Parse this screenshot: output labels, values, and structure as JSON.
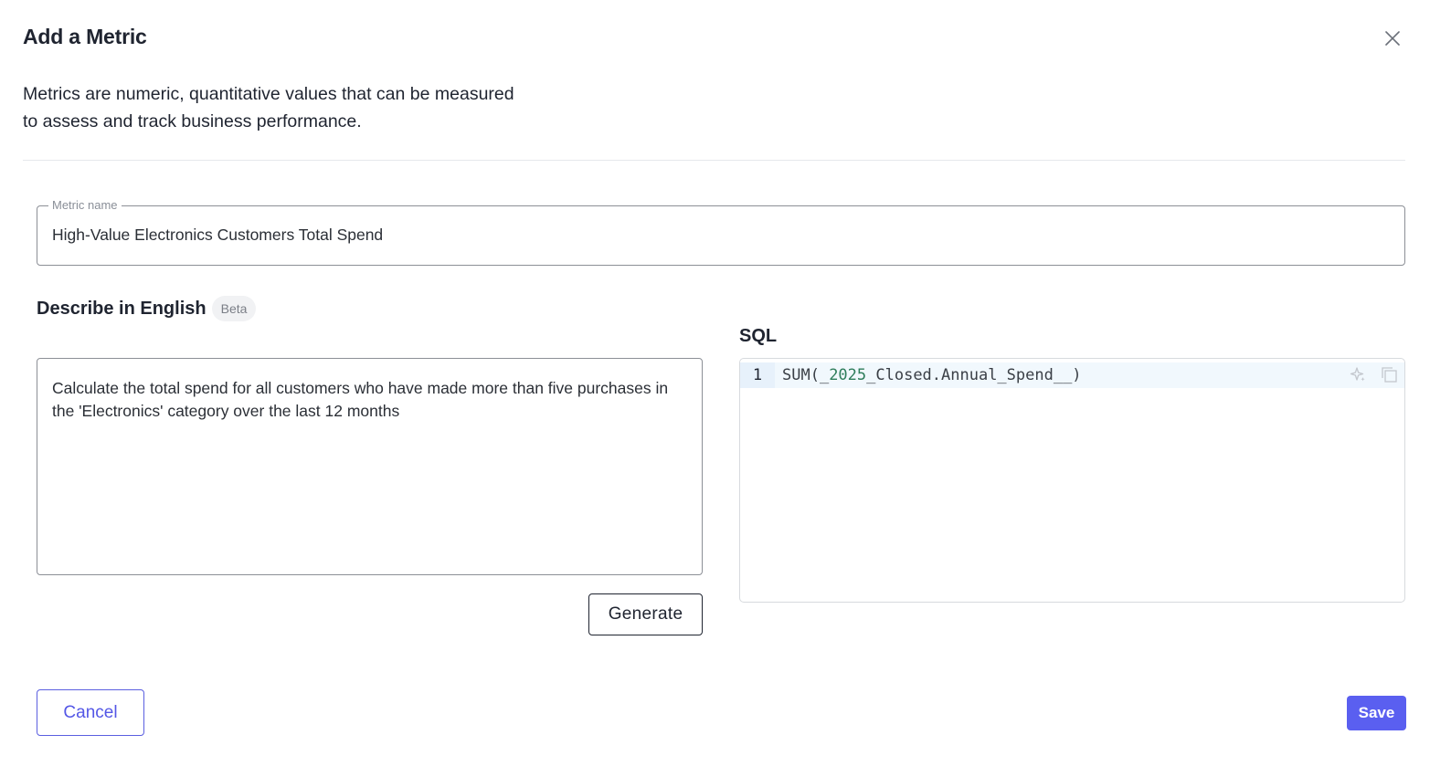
{
  "dialog": {
    "title": "Add a Metric",
    "description_line1": "Metrics are numeric, quantitative values that can be measured",
    "description_line2": "to assess and track business performance."
  },
  "metric_name": {
    "label": "Metric name",
    "value": "High-Value Electronics Customers Total Spend"
  },
  "describe": {
    "title": "Describe in English",
    "badge": "Beta",
    "text": "Calculate the total spend for all customers who have made more than five purchases in the 'Electronics' category over the last 12 months",
    "generate_label": "Generate"
  },
  "sql": {
    "title": "SQL",
    "line_number": "1",
    "code_prefix": "SUM(_",
    "code_number": "2025",
    "code_suffix": "_Closed.Annual_Spend__)",
    "tools": [
      "sparkle-icon",
      "copy-icon"
    ]
  },
  "footer": {
    "cancel_label": "Cancel",
    "save_label": "Save"
  },
  "colors": {
    "primary": "#5a5ff0",
    "border": "#8c8f96"
  }
}
